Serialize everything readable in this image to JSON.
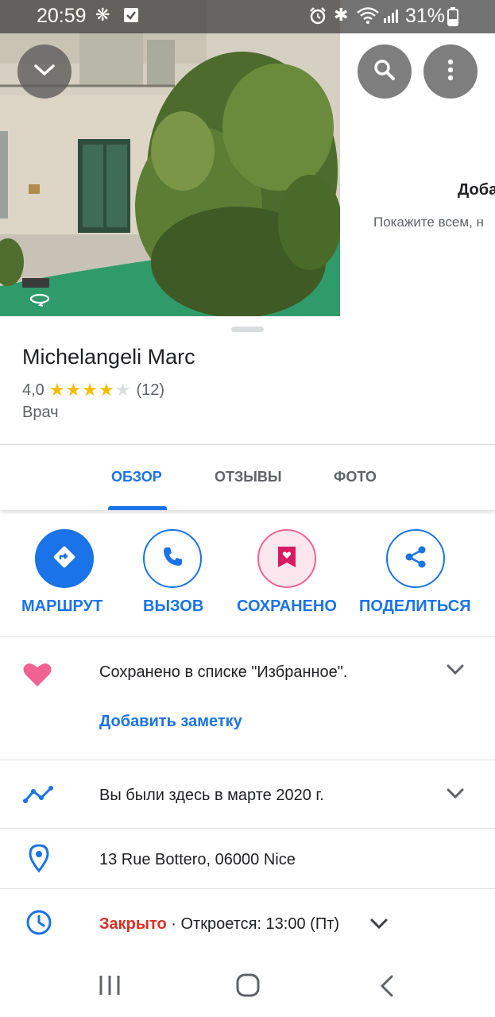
{
  "status_bar": {
    "time": "20:59",
    "battery": "31%"
  },
  "hero": {
    "side_panel_title": "Доба",
    "side_panel_subtitle": "Покажите всем, н"
  },
  "place": {
    "name": "Michelangeli Marc",
    "rating": "4,0",
    "rating_value": 4,
    "rating_max": 5,
    "reviews_count": "(12)",
    "category": "Врач"
  },
  "tabs": [
    {
      "label": "ОБЗОР",
      "active": true
    },
    {
      "label": "ОТЗЫВЫ",
      "active": false
    },
    {
      "label": "ФОТО",
      "active": false
    }
  ],
  "actions": [
    {
      "label": "МАРШРУТ",
      "icon": "directions-icon"
    },
    {
      "label": "ВЫЗОВ",
      "icon": "phone-icon"
    },
    {
      "label": "СОХРАНЕНО",
      "icon": "saved-bookmark-icon"
    },
    {
      "label": "ПОДЕЛИТЬСЯ",
      "icon": "share-icon"
    }
  ],
  "saved": {
    "text": "Сохранено в списке \"Избранное\".",
    "add_note": "Добавить заметку"
  },
  "visited": {
    "text": "Вы были здесь в марте 2020 г."
  },
  "address": {
    "text": "13 Rue Bottero, 06000 Nice"
  },
  "hours": {
    "status": "Закрыто",
    "separator": " · ",
    "opens": "Откроется: 13:00 (Пт)"
  },
  "colors": {
    "accent": "#1a73e8",
    "closed": "#d93025",
    "heart": "#f06292",
    "star": "#fbbc04"
  }
}
